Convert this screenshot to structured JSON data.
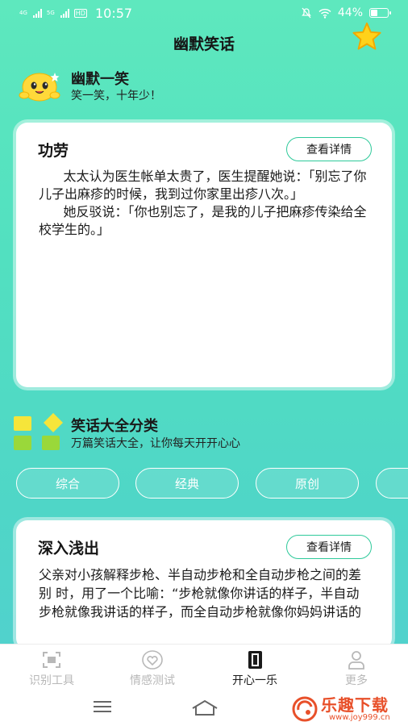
{
  "status_bar": {
    "net1": "4G",
    "net2": "5G",
    "hd": "HD",
    "time": "10:57",
    "battery": "44%",
    "battery_level": 0.44
  },
  "header": {
    "title": "幽默笑话"
  },
  "hero": {
    "title": "幽默一笑",
    "subtitle": "笑一笑，十年少！"
  },
  "jokes": [
    {
      "title": "功劳",
      "detail_label": "查看详情",
      "body": "      太太认为医生帐单太贵了，医生提醒她说：「别忘了你儿子出麻疹的时候，我到过你家里出疹八次。」\n      她反驳说：「你也别忘了，是我的儿子把麻疹传染给全校学生的。」"
    },
    {
      "title": "深入浅出",
      "detail_label": "查看详情",
      "body": "父亲对小孩解释步枪、半自动步枪和全自动步枪之间的差别 时，用了一个比喻：“步枪就像你讲话的样子，半自动步枪就像我讲话的样子，而全自动步枪就像你妈妈讲话的"
    }
  ],
  "category": {
    "title": "笑话大全分类",
    "subtitle": "万篇笑话大全，让你每天开开心心",
    "tabs": [
      "综合",
      "经典",
      "原创",
      ""
    ]
  },
  "bottom_nav": [
    {
      "label": "识别工具",
      "icon": "scan-icon"
    },
    {
      "label": "情感测试",
      "icon": "heart-icon"
    },
    {
      "label": "开心一乐",
      "icon": "notebook-icon",
      "active": true
    },
    {
      "label": "更多",
      "icon": "user-icon"
    }
  ],
  "watermark": {
    "text": "乐趣下载",
    "url": "www.joy999.cn"
  },
  "colors": {
    "accent": "#2ec99a",
    "background": "#55e0c4",
    "watermark": "#e8502a"
  }
}
